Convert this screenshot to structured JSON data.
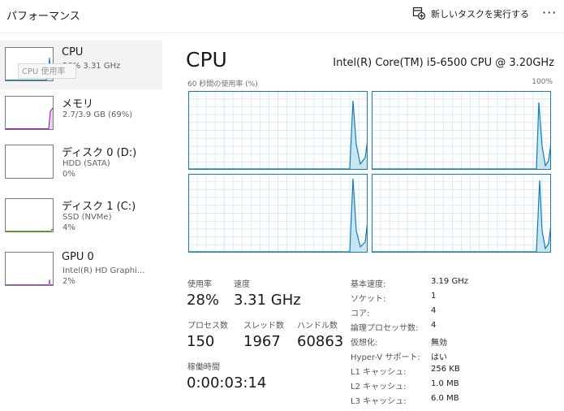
{
  "header": {
    "title": "パフォーマンス",
    "new_task_label": "新しいタスクを実行する",
    "more_label": "···"
  },
  "sidebar": {
    "items": [
      {
        "name": "CPU",
        "sub": "28%  3.31 GHz",
        "value": ""
      },
      {
        "name": "メモリ",
        "sub": "2.7/3.9 GB (69%)",
        "value": ""
      },
      {
        "name": "ディスク 0 (D:)",
        "sub": "HDD (SATA)",
        "value": "0%"
      },
      {
        "name": "ディスク 1 (C:)",
        "sub": "SSD (NVMe)",
        "value": "4%"
      },
      {
        "name": "GPU 0",
        "sub": "Intel(R) HD Graphi...",
        "value": "2%"
      }
    ],
    "tooltip": "CPU 使用率"
  },
  "main": {
    "title": "CPU",
    "model": "Intel(R) Core(TM) i5-6500 CPU @ 3.20GHz",
    "graph_label_left": "60 秒間の使用率 (%)",
    "graph_label_right": "100%"
  },
  "stats": {
    "usage_label": "使用率",
    "usage": "28%",
    "speed_label": "速度",
    "speed": "3.31 GHz",
    "processes_label": "プロセス数",
    "processes": "150",
    "threads_label": "スレッド数",
    "threads": "1967",
    "handles_label": "ハンドル数",
    "handles": "60863",
    "uptime_label": "稼働時間",
    "uptime": "0:00:03:14"
  },
  "info": [
    {
      "label": "基本速度:",
      "value": "3.19 GHz"
    },
    {
      "label": "ソケット:",
      "value": "1"
    },
    {
      "label": "コア:",
      "value": "4"
    },
    {
      "label": "論理プロセッサ数:",
      "value": "4"
    },
    {
      "label": "仮想化:",
      "value": "無効"
    },
    {
      "label": "Hyper-V サポート:",
      "value": "はい"
    },
    {
      "label": "L1 キャッシュ:",
      "value": "256 KB"
    },
    {
      "label": "L2 キャッシュ:",
      "value": "1.0 MB"
    },
    {
      "label": "L3 キャッシュ:",
      "value": "6.0 MB"
    }
  ],
  "colors": {
    "cpu_line": "#117dbb",
    "cpu_fill": "#c8e6f2",
    "grid": "#d9eaf4",
    "gpu_line": "#a74ec1"
  }
}
